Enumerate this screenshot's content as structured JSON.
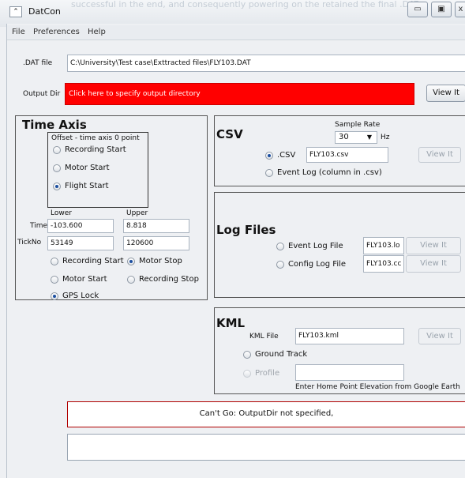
{
  "background_text": "successful in the end, and consequently powering on the retained the final .DAT files, which was then reviewed within",
  "window": {
    "title": "DatCon",
    "icon": "app-menu-icon",
    "btn_min": "▭",
    "btn_max": "▣",
    "btn_close": "x"
  },
  "menu": [
    "File",
    "Preferences",
    "Help"
  ],
  "dat_file": {
    "label": ".DAT file",
    "value": "C:\\University\\Test case\\Exttracted files\\FLY103.DAT"
  },
  "output_dir": {
    "label": "Output Dir",
    "placeholder": "Click here to specify output directory",
    "view_button": "View It",
    "color": "#ff0000"
  },
  "time_axis": {
    "title": "Time Axis",
    "offset_label": "Offset - time axis 0 point",
    "offset_options": [
      "Recording Start",
      "Motor Start",
      "Flight Start"
    ],
    "offset_selected": "Flight Start",
    "lower_label": "Lower",
    "upper_label": "Upper",
    "time_label": "Time",
    "time_lower": "-103.600",
    "time_upper": "8.818",
    "tickno_label": "TickNo",
    "tick_lower": "53149",
    "tick_upper": "120600",
    "range_options": [
      "Recording Start",
      "Motor Stop",
      "Motor Start",
      "Recording Stop",
      "GPS Lock"
    ],
    "range_selected": [
      "Motor Stop",
      "GPS Lock"
    ]
  },
  "csv": {
    "title": "CSV",
    "sample_rate_label": "Sample Rate",
    "sample_rate": "30",
    "hz": "Hz",
    "csv_option": ".CSV",
    "csv_file": "FLY103.csv",
    "view_button": "View It",
    "event_log_option": "Event Log (column in .csv)"
  },
  "log_files": {
    "title": "Log Files",
    "event_log_label": "Event Log File",
    "event_log_file": "FLY103.lo",
    "config_log_label": "Config Log File",
    "config_log_file": "FLY103.cc",
    "view_button": "View It"
  },
  "kml": {
    "title": "KML",
    "kml_file_label": "KML File",
    "kml_file": "FLY103.kml",
    "view_button": "View It",
    "ground_track": "Ground Track",
    "profile": "Profile",
    "profile_value": "",
    "home_elev_label": "Enter Home Point Elevation from Google Earth"
  },
  "status": {
    "message": "Can't Go: OutputDir not specified,",
    "color": "#b00000"
  }
}
